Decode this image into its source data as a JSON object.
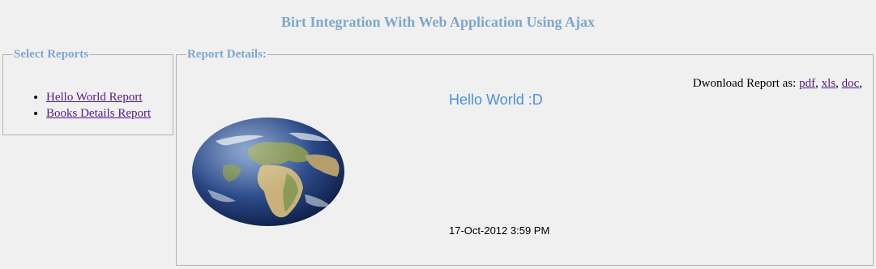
{
  "page": {
    "title": "Birt Integration With Web Application Using Ajax"
  },
  "select_reports": {
    "legend": "Select Reports",
    "items": [
      {
        "label": "Hello World Report"
      },
      {
        "label": "Books Details Report"
      }
    ]
  },
  "report_details": {
    "legend": "Report Details:",
    "download_label": "Dwonload Report as: ",
    "download_formats": [
      {
        "label": "pdf"
      },
      {
        "label": "xls"
      },
      {
        "label": "doc"
      }
    ],
    "hello_title": "Hello World :D",
    "date": "17-Oct-2012 3:59 PM",
    "image_icon": "earth-globe-icon"
  },
  "colors": {
    "title": "#7fa6cf",
    "legend": "#7fa6cf",
    "hello_title": "#4a90e2",
    "link": "#551a8b",
    "background": "#f0f0f0"
  }
}
